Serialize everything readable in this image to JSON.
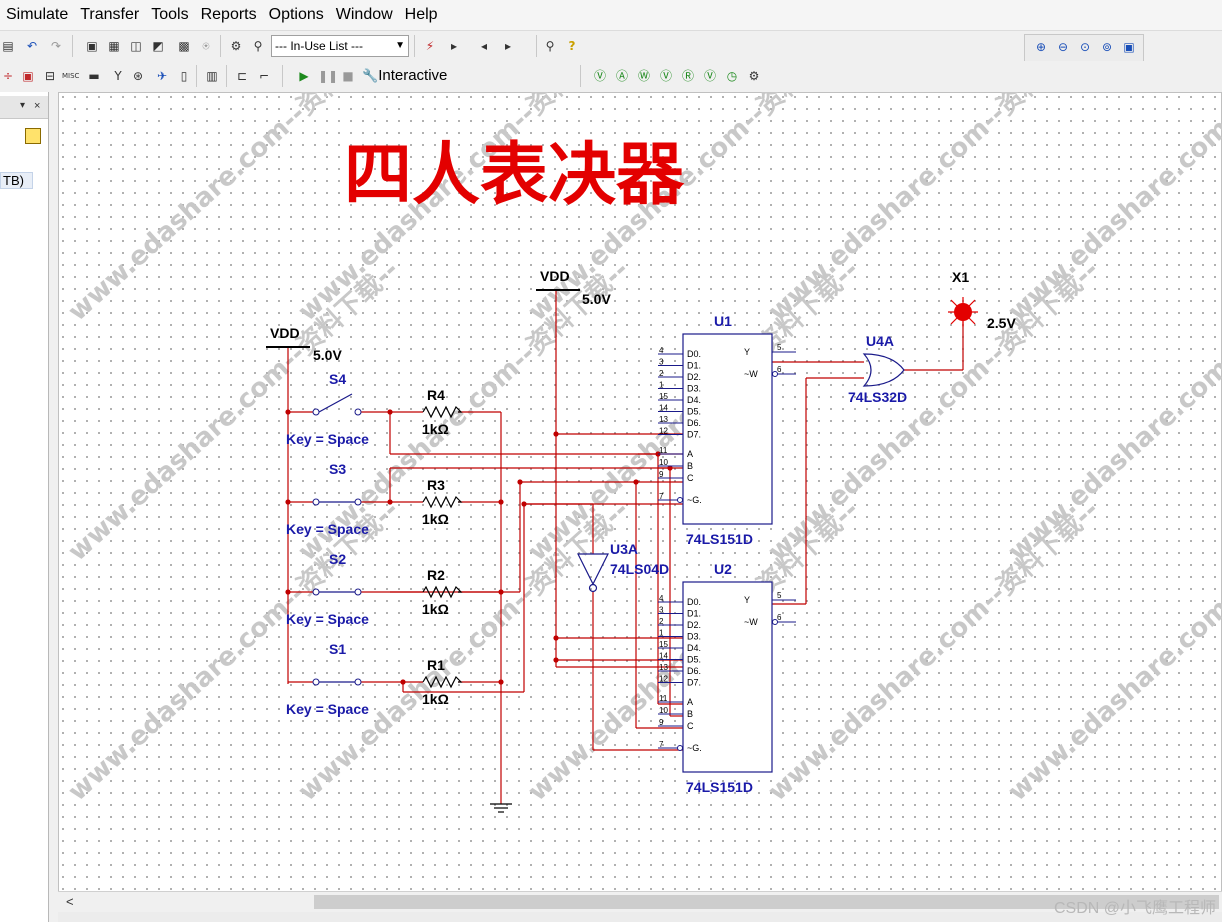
{
  "menu": [
    "Simulate",
    "Transfer",
    "Tools",
    "Reports",
    "Options",
    "Window",
    "Help"
  ],
  "toolbar": {
    "inuse_list": "--- In-Use List ---",
    "interactive_label": "Interactive",
    "msc_label": "MISC"
  },
  "left_panel": {
    "tree_item": "TB)",
    "close": "×",
    "pin": "▾"
  },
  "schematic": {
    "title": "四人表决器",
    "vdd_top": {
      "label": "VDD",
      "voltage": "5.0V"
    },
    "vdd_left": {
      "label": "VDD",
      "voltage": "5.0V"
    },
    "switches": [
      {
        "name": "S4",
        "key": "Key = Space"
      },
      {
        "name": "S3",
        "key": "Key = Space"
      },
      {
        "name": "S2",
        "key": "Key = Space"
      },
      {
        "name": "S1",
        "key": "Key = Space"
      }
    ],
    "resistors": [
      {
        "name": "R4",
        "value": "1kΩ"
      },
      {
        "name": "R3",
        "value": "1kΩ"
      },
      {
        "name": "R2",
        "value": "1kΩ"
      },
      {
        "name": "R1",
        "value": "1kΩ"
      }
    ],
    "u1": {
      "ref": "U1",
      "part": "74LS151D"
    },
    "u2": {
      "ref": "U2",
      "part": "74LS151D"
    },
    "u3": {
      "ref": "U3A",
      "part": "74LS04D"
    },
    "u4": {
      "ref": "U4A",
      "part": "74LS32D"
    },
    "probe": {
      "ref": "X1",
      "voltage": "2.5V"
    },
    "mux_inputs": [
      "D0",
      "D1",
      "D2",
      "D3",
      "D4",
      "D5",
      "D6",
      "D7"
    ],
    "mux_input_pins": [
      "4",
      "3",
      "2",
      "1",
      "15",
      "14",
      "13",
      "12"
    ],
    "mux_select": [
      "A",
      "B",
      "C",
      "~G"
    ],
    "mux_select_pins": [
      "11",
      "10",
      "9",
      "7"
    ],
    "mux_outputs": [
      "Y",
      "~W"
    ],
    "mux_output_pins": [
      "5",
      "6"
    ],
    "watermark": "www.edashare.com--资料下载--"
  },
  "footer": {
    "credit": "CSDN @小飞鹰工程师"
  }
}
